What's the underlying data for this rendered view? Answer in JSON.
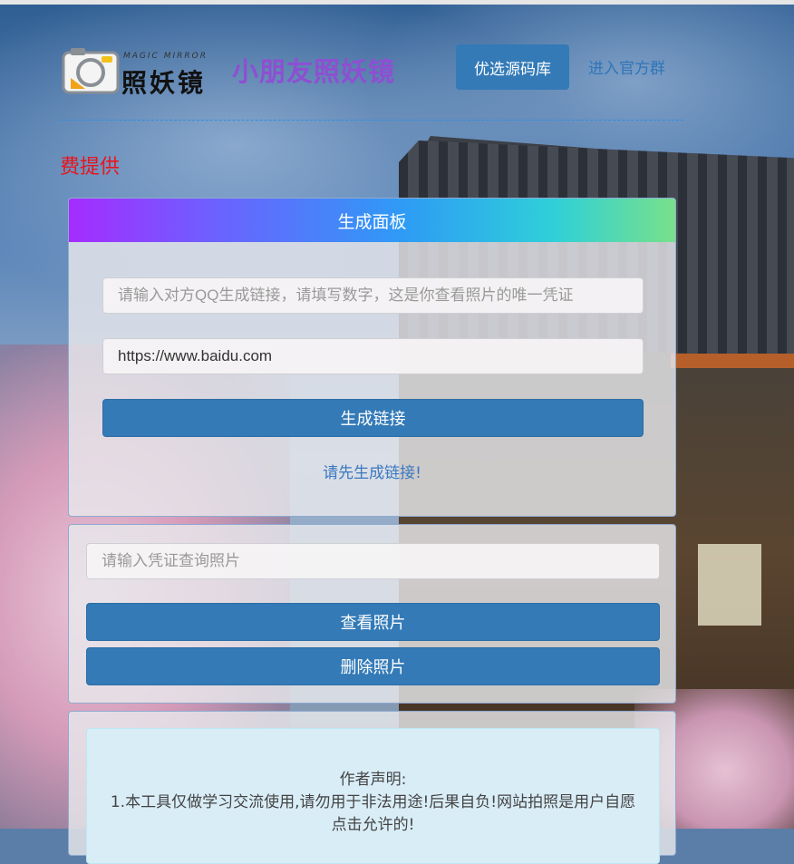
{
  "header": {
    "logo_subtitle": "MAGIC MIRROR",
    "logo_text": "照妖镜",
    "site_title": "小朋友照妖镜",
    "nav_primary": "优选源码库",
    "nav_link": "进入官方群"
  },
  "notice": "费提供",
  "generator": {
    "title": "生成面板",
    "qq_placeholder": "请输入对方QQ生成链接，请填写数字，这是你查看照片的唯一凭证",
    "url_value": "https://www.baidu.com",
    "generate_button": "生成链接",
    "status": "请先生成链接!"
  },
  "viewer": {
    "credential_placeholder": "请输入凭证查询照片",
    "view_button": "查看照片",
    "delete_button": "删除照片"
  },
  "declaration": {
    "heading": "作者声明:",
    "line1": "1.本工具仅做学习交流使用,请勿用于非法用途!后果自负!网站拍照是用户自愿",
    "line2": "点击允许的!"
  },
  "colors": {
    "primary": "#337ab7",
    "title_purple": "#8e4fd2",
    "notice_red": "#e8151e",
    "link_blue": "#2f75b8"
  },
  "icons": {
    "logo": "camera-icon"
  }
}
